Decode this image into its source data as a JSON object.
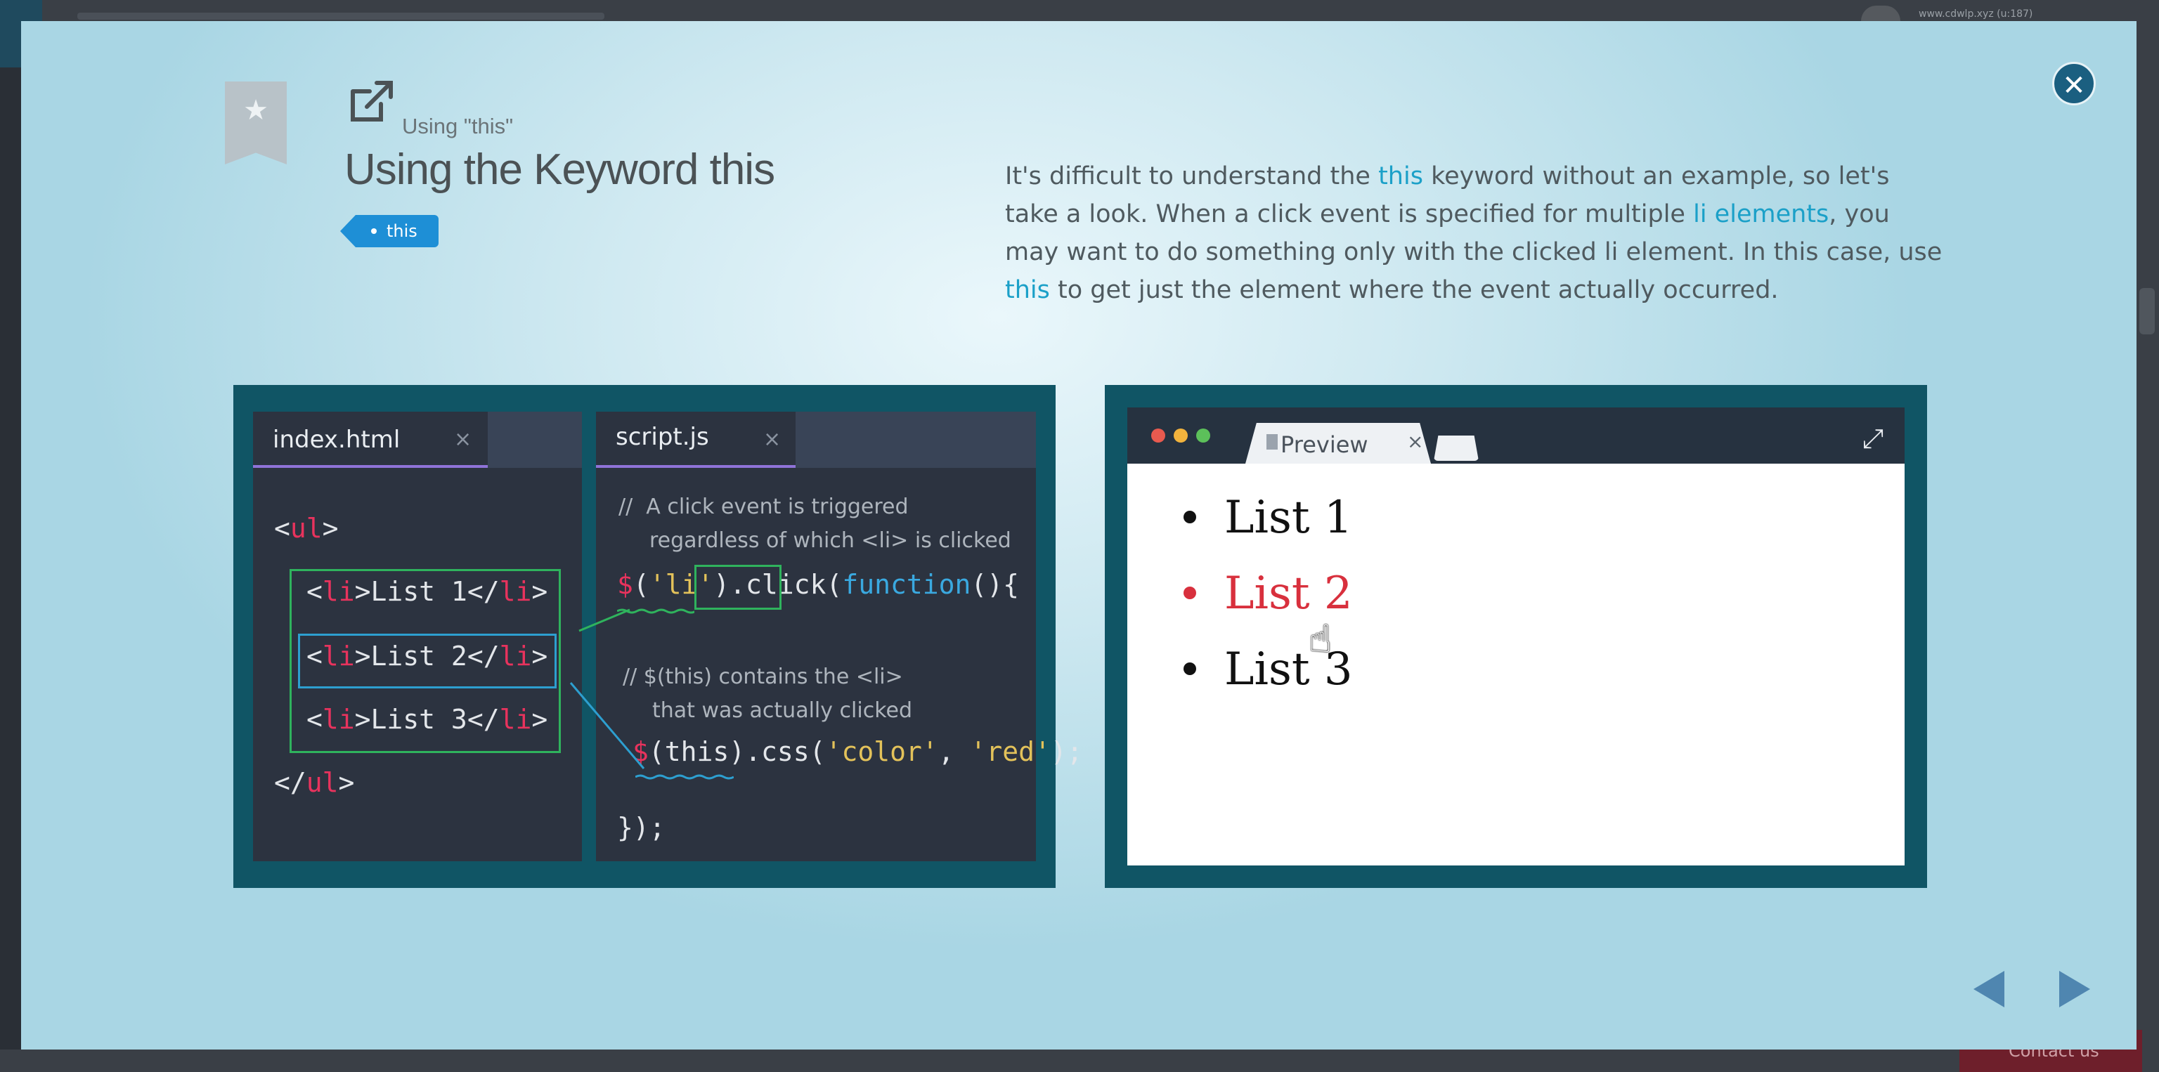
{
  "background": {
    "url_snippet": "www.cdwlp.xyz (u:187)",
    "contact_label": "Contact us"
  },
  "modal": {
    "close_icon": "close-icon",
    "bookmark_icon": "star-bookmark-icon",
    "external_link_icon": "external-link-icon",
    "subtitle": "Using \"this\"",
    "title": "Using the Keyword this",
    "tag": "this",
    "description": {
      "p1": "It's difficult to understand the ",
      "kw1": "this",
      "p2": " keyword without an example, so let's take a look. When a click event is specified for multiple ",
      "kw2": "li elements",
      "p3": ", you may want to do something only with the clicked li element. In this case, use ",
      "kw3": "this",
      "p4": " to get just the element where the event actually occurred."
    }
  },
  "code_html": {
    "tab_label": "index.html",
    "tab_close": "×",
    "ul_open": "<ul>",
    "items": [
      "List 1",
      "List 2",
      "List 3"
    ],
    "ul_close": "</ul>"
  },
  "code_js": {
    "tab_label": "script.js",
    "tab_close": "×",
    "comment1_line1": "//  A click event is triggered",
    "comment1_line2": "regardless of which <li> is clicked",
    "call_line": "$('li').click(function(){",
    "comment2_line1": "// $(this) contains the <li>",
    "comment2_line2": "that was actually clicked",
    "css_line": "$(this).css('color', 'red');",
    "end_line": "});"
  },
  "preview": {
    "tab_label": "Preview",
    "tab_close": "×",
    "expand_icon": "expand-icon",
    "items": [
      "List 1",
      "List 2",
      "List 3"
    ],
    "clicked_index": 1,
    "clicked_color": "#d8303d"
  },
  "navigation": {
    "prev_icon": "prev-arrow-icon",
    "next_icon": "next-arrow-icon"
  },
  "colors": {
    "accent": "#1ba0c8",
    "panel_bg": "#105565",
    "editor_bg": "#2c3340",
    "tag_bg": "#1e8fd6"
  }
}
